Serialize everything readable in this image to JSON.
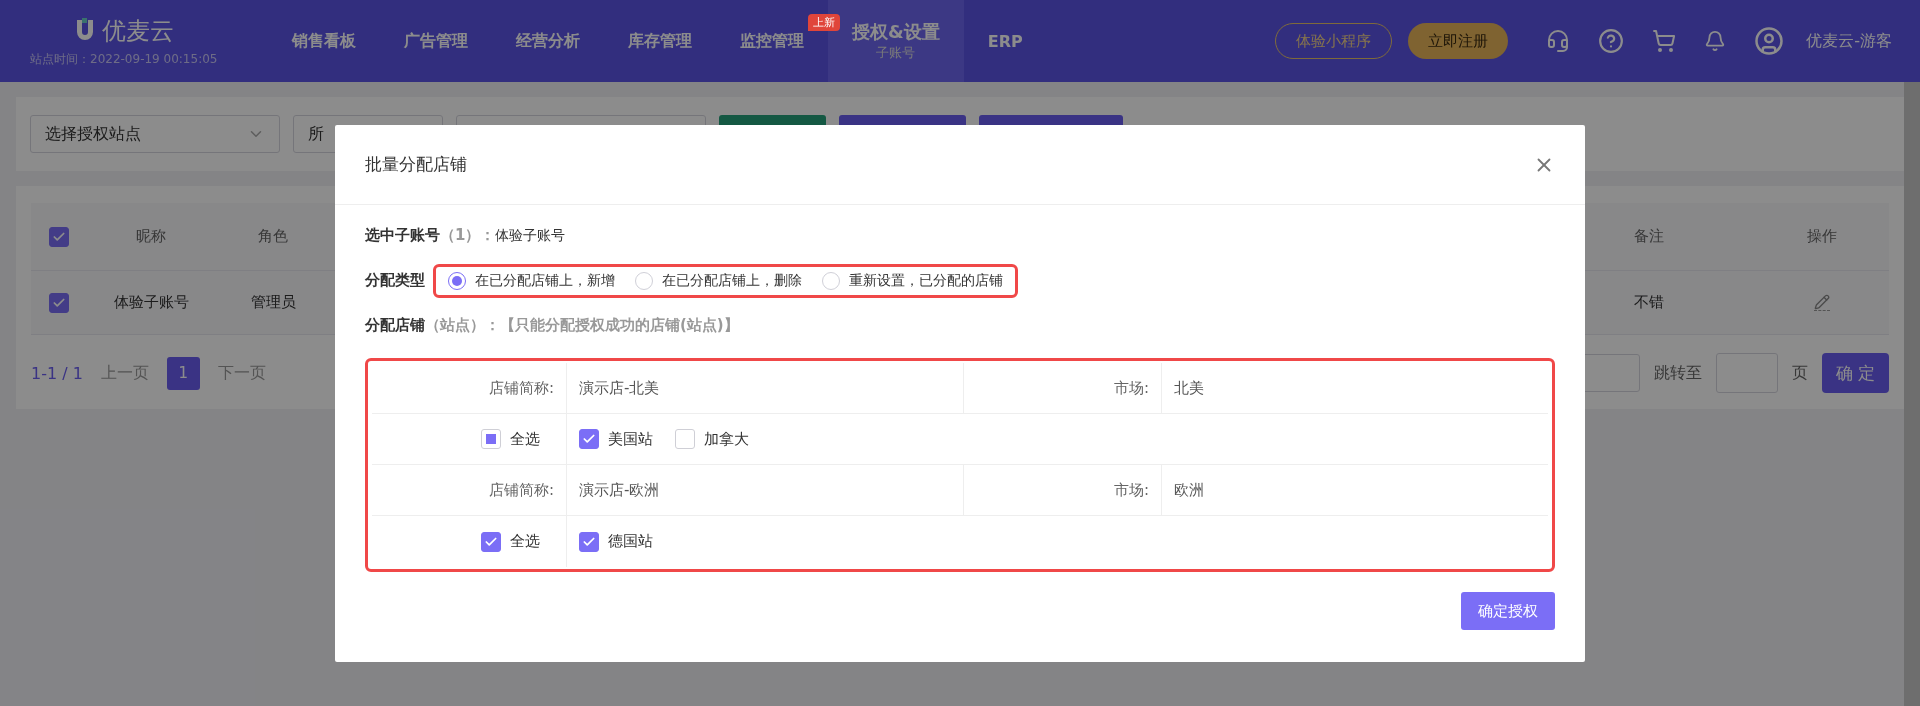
{
  "header": {
    "logo_text": "优麦云",
    "site_time": "站点时间：2022-09-19 00:15:05",
    "nav": [
      {
        "label": "销售看板",
        "selected": false
      },
      {
        "label": "广告管理",
        "selected": false
      },
      {
        "label": "经营分析",
        "selected": false
      },
      {
        "label": "库存管理",
        "selected": false
      },
      {
        "label": "监控管理",
        "selected": false,
        "badge": "上新"
      },
      {
        "label": "授权&设置",
        "selected": true,
        "sub": "子账号"
      },
      {
        "label": "ERP",
        "selected": false
      }
    ],
    "mini_program_button": "体验小程序",
    "register_button": "立即注册",
    "user_name": "优麦云-游客"
  },
  "filters": {
    "site_select": "选择授权站点",
    "second_select": "所"
  },
  "table": {
    "header_checked": true,
    "columns": [
      "昵称",
      "角色",
      "备注",
      "操作"
    ],
    "rows": [
      {
        "checked": true,
        "nickname": "体验子账号",
        "role": "管理员",
        "remark": "不错"
      }
    ]
  },
  "pagination": {
    "range": "1-1 / 1",
    "prev": "上一页",
    "page": "1",
    "next": "下一页",
    "jump_label": "跳转至",
    "page_unit": "页",
    "confirm": "确 定"
  },
  "modal": {
    "title": "批量分配店铺",
    "selected_account": {
      "label": "选中子账号",
      "count": "（1）：",
      "value": "体验子账号"
    },
    "assign_type": {
      "label": "分配类型",
      "highlighted": true,
      "options": [
        {
          "label": "在已分配店铺上，新增",
          "selected": true
        },
        {
          "label": "在已分配店铺上，删除",
          "selected": false
        },
        {
          "label": "重新设置，已分配的店铺",
          "selected": false
        }
      ]
    },
    "store_heading": {
      "label": "分配店铺",
      "sub": "（站点）：",
      "note": "【只能分配授权成功的店铺(站点)】"
    },
    "stores_highlighted": true,
    "stores": [
      {
        "name_label": "店铺简称:",
        "name": "演示店-北美",
        "market_label": "市场:",
        "market": "北美",
        "select_all": {
          "label": "全选",
          "checked": false,
          "indeterminate": true
        },
        "sites": [
          {
            "label": "美国站",
            "checked": true
          },
          {
            "label": "加拿大",
            "checked": false
          }
        ]
      },
      {
        "name_label": "店铺简称:",
        "name": "演示店-欧洲",
        "market_label": "市场:",
        "market": "欧洲",
        "select_all": {
          "label": "全选",
          "checked": true
        },
        "sites": [
          {
            "label": "德国站",
            "checked": true
          }
        ]
      }
    ],
    "confirm_button": "确定授权"
  }
}
